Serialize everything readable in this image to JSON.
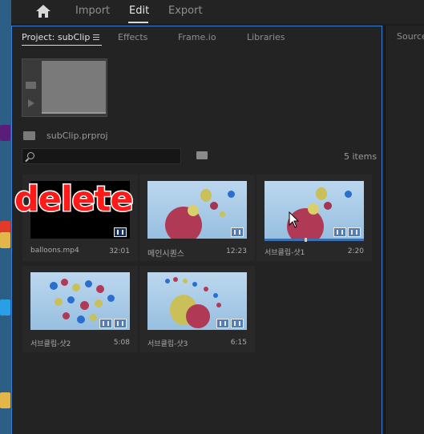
{
  "nav": {
    "home_icon": "home-icon",
    "tabs": [
      "Import",
      "Edit",
      "Export"
    ],
    "active": "Edit"
  },
  "project_panel": {
    "tabs": [
      "Project: subClip",
      "Effects",
      "Frame.io",
      "Libraries"
    ],
    "active_tab": "Project: subClip",
    "project_file": "subClip.prproj",
    "search_placeholder": "",
    "item_count": "5 items"
  },
  "clips": [
    {
      "name": "balloons.mp4",
      "duration": "32:01"
    },
    {
      "name": "메인시퀀스",
      "duration": "12:23"
    },
    {
      "name": "서브클립-샷1",
      "duration": "2:20"
    },
    {
      "name": "서브클립-샷2",
      "duration": "5:08"
    },
    {
      "name": "서브클립-샷3",
      "duration": "6:15"
    }
  ],
  "overlay": {
    "label": "delete"
  },
  "source_panel": {
    "title": "Source"
  },
  "colors": {
    "accent": "#3f7fd3",
    "overlay_text": "#ff1a1a"
  }
}
